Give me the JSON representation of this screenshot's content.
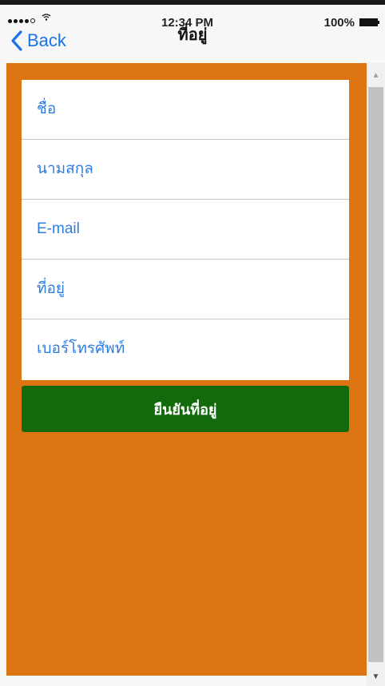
{
  "status_bar": {
    "time": "12:34 PM",
    "battery_percent": "100%",
    "signal_icon": "signal-dots-icon",
    "wifi_icon": "wifi-icon",
    "battery_icon": "battery-icon"
  },
  "nav": {
    "back_label": "Back",
    "back_icon": "chevron-left-icon",
    "title": "ที่อยู่"
  },
  "form": {
    "fields": [
      {
        "label": "ชื่อ"
      },
      {
        "label": "นามสกุล"
      },
      {
        "label": "E-mail"
      },
      {
        "label": "ที่อยู่"
      },
      {
        "label": "เบอร์โทรศัพท์"
      }
    ],
    "confirm_label": "ยืนยันที่อยู่"
  },
  "colors": {
    "background": "#dd7512",
    "button": "#136a0c",
    "field_label": "#2f7de1",
    "link": "#1a73e8"
  }
}
